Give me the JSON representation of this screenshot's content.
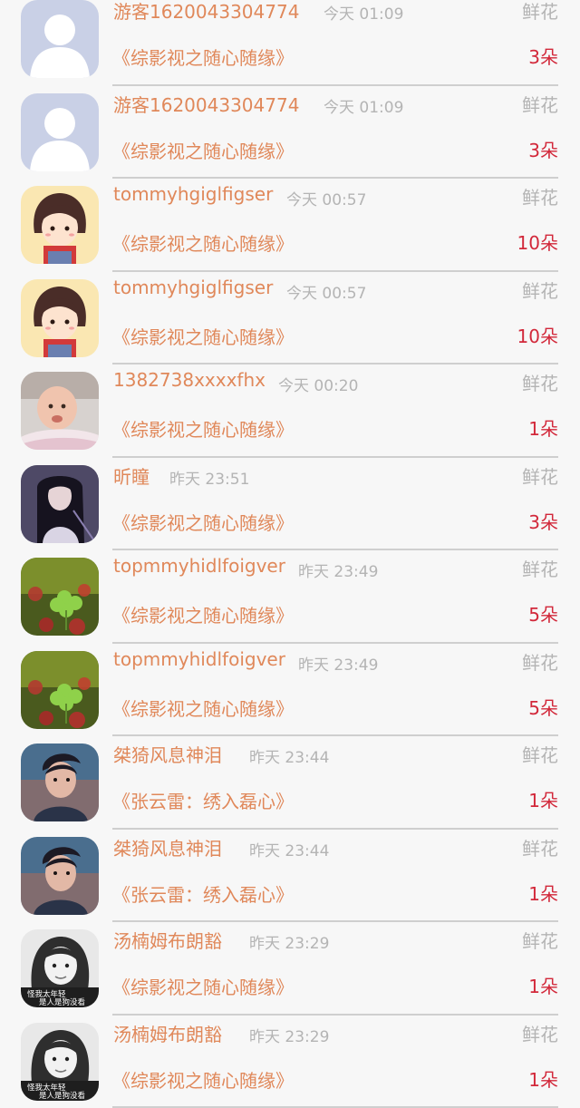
{
  "rewards": [
    {
      "name": "游客1620043304774",
      "time": "今天 01:09",
      "gift": "鲜花",
      "book": "《综影视之随心随缘》",
      "count": "3朵",
      "avatar": "default-avatar"
    },
    {
      "name": "游客1620043304774",
      "time": "今天 01:09",
      "gift": "鲜花",
      "book": "《综影视之随心随缘》",
      "count": "3朵",
      "avatar": "default-avatar"
    },
    {
      "name": "tommyhgiglfigser",
      "time": "今天 00:57",
      "gift": "鲜花",
      "book": "《综影视之随心随缘》",
      "count": "10朵",
      "avatar": "cartoon-girl-avatar"
    },
    {
      "name": "tommyhgiglfigser",
      "time": "今天 00:57",
      "gift": "鲜花",
      "book": "《综影视之随心随缘》",
      "count": "10朵",
      "avatar": "cartoon-girl-avatar"
    },
    {
      "name": "1382738xxxxfhx",
      "time": "今天 00:20",
      "gift": "鲜花",
      "book": "《综影视之随心随缘》",
      "count": "1朵",
      "avatar": "baby-photo-avatar"
    },
    {
      "name": "昕瞳",
      "time": "昨天 23:51",
      "gift": "鲜花",
      "book": "《综影视之随心随缘》",
      "count": "3朵",
      "avatar": "anime-girl-avatar"
    },
    {
      "name": "topmmyhidlfoigver",
      "time": "昨天 23:49",
      "gift": "鲜花",
      "book": "《综影视之随心随缘》",
      "count": "5朵",
      "avatar": "clover-avatar"
    },
    {
      "name": "topmmyhidlfoigver",
      "time": "昨天 23:49",
      "gift": "鲜花",
      "book": "《综影视之随心随缘》",
      "count": "5朵",
      "avatar": "clover-avatar"
    },
    {
      "name": "桀猗风息神泪",
      "time": "昨天 23:44",
      "gift": "鲜花",
      "book": "《张云雷：绣入磊心》",
      "count": "1朵",
      "avatar": "young-man-avatar"
    },
    {
      "name": "桀猗风息神泪",
      "time": "昨天 23:44",
      "gift": "鲜花",
      "book": "《张云雷：绣入磊心》",
      "count": "1朵",
      "avatar": "young-man-avatar"
    },
    {
      "name": "汤楠姆布朗豁",
      "time": "昨天 23:29",
      "gift": "鲜花",
      "book": "《综影视之随心随缘》",
      "count": "1朵",
      "avatar": "bw-girl-avatar",
      "avatar_caption": [
        "怪我太年轻",
        "是人是狗没看"
      ]
    },
    {
      "name": "汤楠姆布朗豁",
      "time": "昨天 23:29",
      "gift": "鲜花",
      "book": "《综影视之随心随缘》",
      "count": "1朵",
      "avatar": "bw-girl-avatar",
      "avatar_caption": [
        "怪我太年轻",
        "是人是狗没看"
      ]
    }
  ]
}
